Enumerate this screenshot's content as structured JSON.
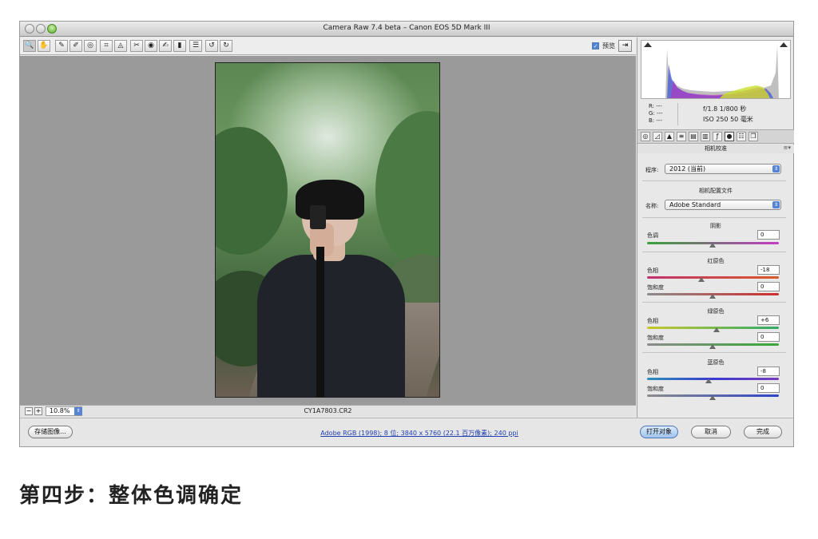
{
  "window": {
    "title": "Camera Raw 7.4 beta –  Canon EOS 5D Mark III"
  },
  "toolbar": {
    "tools": [
      {
        "icon": "zoom-tool-icon",
        "glyph": "🔍"
      },
      {
        "icon": "hand-tool-icon",
        "glyph": "✋"
      },
      {
        "icon": "white-balance-tool-icon",
        "glyph": "✎"
      },
      {
        "icon": "color-sampler-tool-icon",
        "glyph": "✐"
      },
      {
        "icon": "targeted-adjustment-tool-icon",
        "glyph": "◎"
      },
      {
        "icon": "crop-tool-icon",
        "glyph": "⌗"
      },
      {
        "icon": "straighten-tool-icon",
        "glyph": "◬"
      },
      {
        "icon": "spot-removal-tool-icon",
        "glyph": "✂"
      },
      {
        "icon": "red-eye-removal-icon",
        "glyph": "◉"
      },
      {
        "icon": "adjustment-brush-icon",
        "glyph": "✍"
      },
      {
        "icon": "graduated-filter-icon",
        "glyph": "▮"
      },
      {
        "icon": "preferences-icon",
        "glyph": "☰"
      },
      {
        "icon": "rotate-left-icon",
        "glyph": "↺"
      },
      {
        "icon": "rotate-right-icon",
        "glyph": "↻"
      }
    ],
    "preview_label": "预览",
    "preview_checked": true
  },
  "canvas": {
    "zoom": "10.8%",
    "filename": "CY1A7803.CR2"
  },
  "bottombar": {
    "save_label": "存储图像...",
    "workflow_link": "Adobe RGB (1998); 8 位; 3840 x 5760 (22.1 百万像素); 240 ppi",
    "open_label": "打开对象",
    "cancel_label": "取消",
    "done_label": "完成"
  },
  "readout": {
    "r": "R:  ---",
    "g": "G:  ---",
    "b": "B:  ---",
    "exposure": "f/1.8   1/800 秒",
    "iso": "ISO 250   50 毫米"
  },
  "panel": {
    "section_title": "相机校准",
    "process_label": "程序:",
    "process_value": "2012 (当前)",
    "profile_group": "相机配置文件",
    "name_label": "名称:",
    "name_value": "Adobe Standard",
    "shadows_group": "阴影",
    "shadows_tint_label": "色调",
    "shadows_tint_value": "0",
    "red_group": "红原色",
    "red_hue_label": "色相",
    "red_hue_value": "-18",
    "red_sat_label": "饱和度",
    "red_sat_value": "0",
    "green_group": "绿原色",
    "green_hue_label": "色相",
    "green_hue_value": "+6",
    "green_sat_label": "饱和度",
    "green_sat_value": "0",
    "blue_group": "蓝原色",
    "blue_hue_label": "色相",
    "blue_hue_value": "-8",
    "blue_sat_label": "饱和度",
    "blue_sat_value": "0"
  },
  "caption": "第四步：整体色调确定",
  "colors": {
    "canvas_bg": "#9a9a9a",
    "link": "#1f3fb0",
    "accent_blue": "#5783d4"
  }
}
